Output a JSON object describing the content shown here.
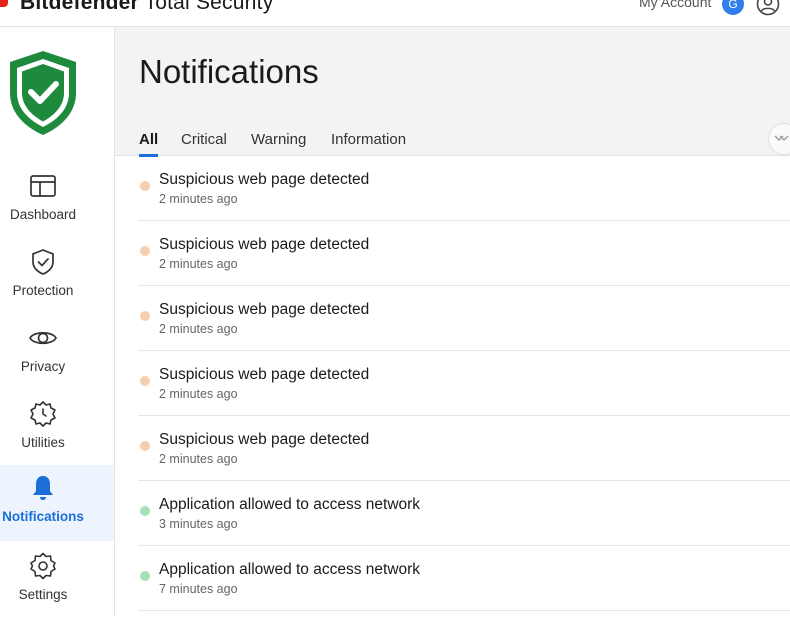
{
  "app": {
    "title_brand": "Bitdefender",
    "title_product": "Total Security",
    "account_label": "My Account",
    "account_initial": "G",
    "brand_color": "#e2231a",
    "accent_color": "#1a6fd9"
  },
  "sidebar": {
    "logo_icon": "shield-check-icon",
    "items": [
      {
        "label": "Dashboard",
        "icon": "dashboard-icon",
        "active": false
      },
      {
        "label": "Protection",
        "icon": "protection-shield-icon",
        "active": false
      },
      {
        "label": "Privacy",
        "icon": "eye-icon",
        "active": false
      },
      {
        "label": "Utilities",
        "icon": "utilities-gear-icon",
        "active": false
      },
      {
        "label": "Notifications",
        "icon": "bell-icon",
        "active": true
      },
      {
        "label": "Settings",
        "icon": "gear-icon",
        "active": false
      }
    ]
  },
  "main": {
    "page_title": "Notifications",
    "tabs": [
      {
        "label": "All",
        "active": true
      },
      {
        "label": "Critical",
        "active": false
      },
      {
        "label": "Warning",
        "active": false
      },
      {
        "label": "Information",
        "active": false
      }
    ],
    "notifications": [
      {
        "title": "Suspicious web page detected",
        "time": "2 minutes ago",
        "status_color": "#f7cfae"
      },
      {
        "title": "Suspicious web page detected",
        "time": "2 minutes ago",
        "status_color": "#f7cfae"
      },
      {
        "title": "Suspicious web page detected",
        "time": "2 minutes ago",
        "status_color": "#f7cfae"
      },
      {
        "title": "Suspicious web page detected",
        "time": "2 minutes ago",
        "status_color": "#f7cfae"
      },
      {
        "title": "Suspicious web page detected",
        "time": "2 minutes ago",
        "status_color": "#f7cfae"
      },
      {
        "title": "Application allowed to access network",
        "time": "3 minutes ago",
        "status_color": "#a7e0b8"
      },
      {
        "title": "Application allowed to access network",
        "time": "7 minutes ago",
        "status_color": "#a7e0b8"
      }
    ]
  }
}
